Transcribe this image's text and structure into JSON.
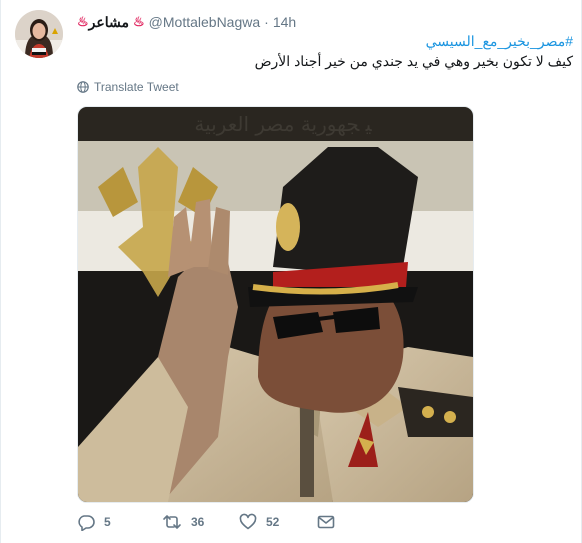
{
  "tweet": {
    "author_name": "مشاعر",
    "author_decor": "♨",
    "handle": "@MottalebNagwa",
    "separator": "·",
    "time": "14h",
    "hashtag": "#مصر_بخير_مع_السيسي",
    "text": "كيف لا تكون بخير وهي في يد جندي من خير أجناد الأرض",
    "translate_label": "Translate Tweet"
  },
  "actions": {
    "reply_count": "5",
    "retweet_count": "36",
    "like_count": "52"
  },
  "icons": {
    "globe": "globe-icon",
    "reply": "reply-icon",
    "retweet": "retweet-icon",
    "like": "heart-icon",
    "message": "envelope-icon"
  },
  "colors": {
    "link": "#1b95e0",
    "text": "#14171a",
    "muted": "#657786",
    "accent": "#e0245e"
  }
}
